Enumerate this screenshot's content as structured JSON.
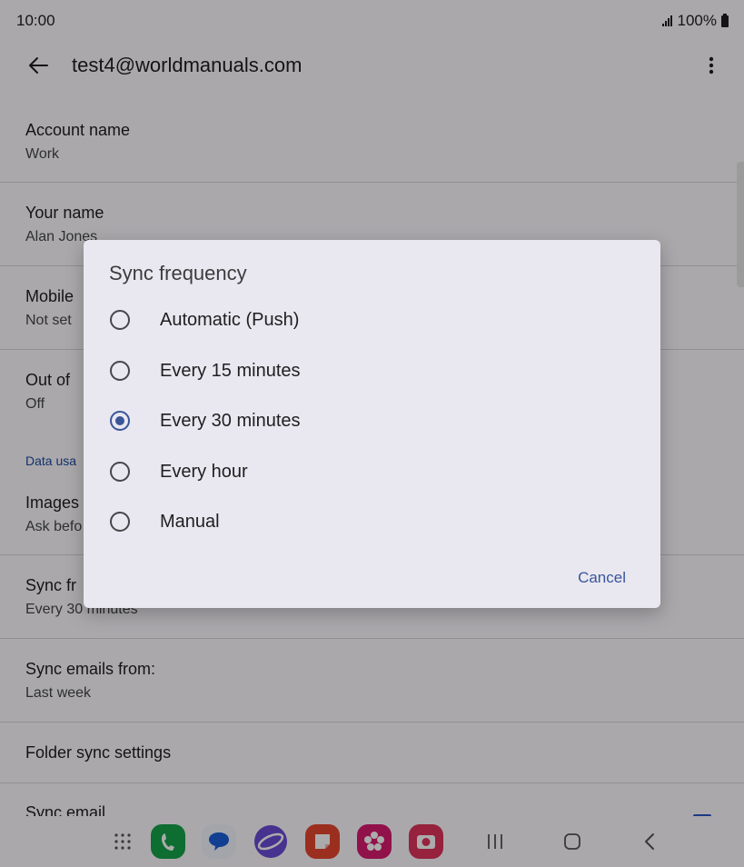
{
  "status_bar": {
    "time": "10:00",
    "battery": "100%"
  },
  "app_bar": {
    "title": "test4@worldmanuals.com",
    "back_icon": "arrow-left-icon",
    "more_icon": "more-vert-icon"
  },
  "settings": {
    "account_name": {
      "title": "Account name",
      "value": "Work"
    },
    "your_name": {
      "title": "Your name",
      "value": "Alan Jones"
    },
    "mobile": {
      "title": "Mobile",
      "value": "Not set"
    },
    "out_of_office": {
      "title": "Out of",
      "value": "Off"
    },
    "data_usage_header": "Data usa",
    "images": {
      "title": "Images",
      "value": "Ask befo"
    },
    "sync_frequency": {
      "title": "Sync fr",
      "value": "Every 30 minutes"
    },
    "sync_emails_from": {
      "title": "Sync emails from:",
      "value": "Last week"
    },
    "folder_sync": {
      "title": "Folder sync settings"
    },
    "sync_email": {
      "title": "Sync email"
    }
  },
  "dialog": {
    "title": "Sync frequency",
    "options": [
      {
        "label": "Automatic (Push)",
        "selected": false
      },
      {
        "label": "Every 15 minutes",
        "selected": false
      },
      {
        "label": "Every 30 minutes",
        "selected": true
      },
      {
        "label": "Every hour",
        "selected": false
      },
      {
        "label": "Manual",
        "selected": false
      }
    ],
    "cancel_label": "Cancel"
  },
  "nav_bar": {
    "apps": [
      "apps-grid-icon",
      "phone-icon",
      "messages-icon",
      "internet-icon",
      "notes-icon",
      "gallery-icon",
      "camera-icon"
    ],
    "buttons": [
      "recents-icon",
      "home-icon",
      "back-icon"
    ]
  },
  "colors": {
    "accent": "#3a5698",
    "scrim": "#000000"
  }
}
